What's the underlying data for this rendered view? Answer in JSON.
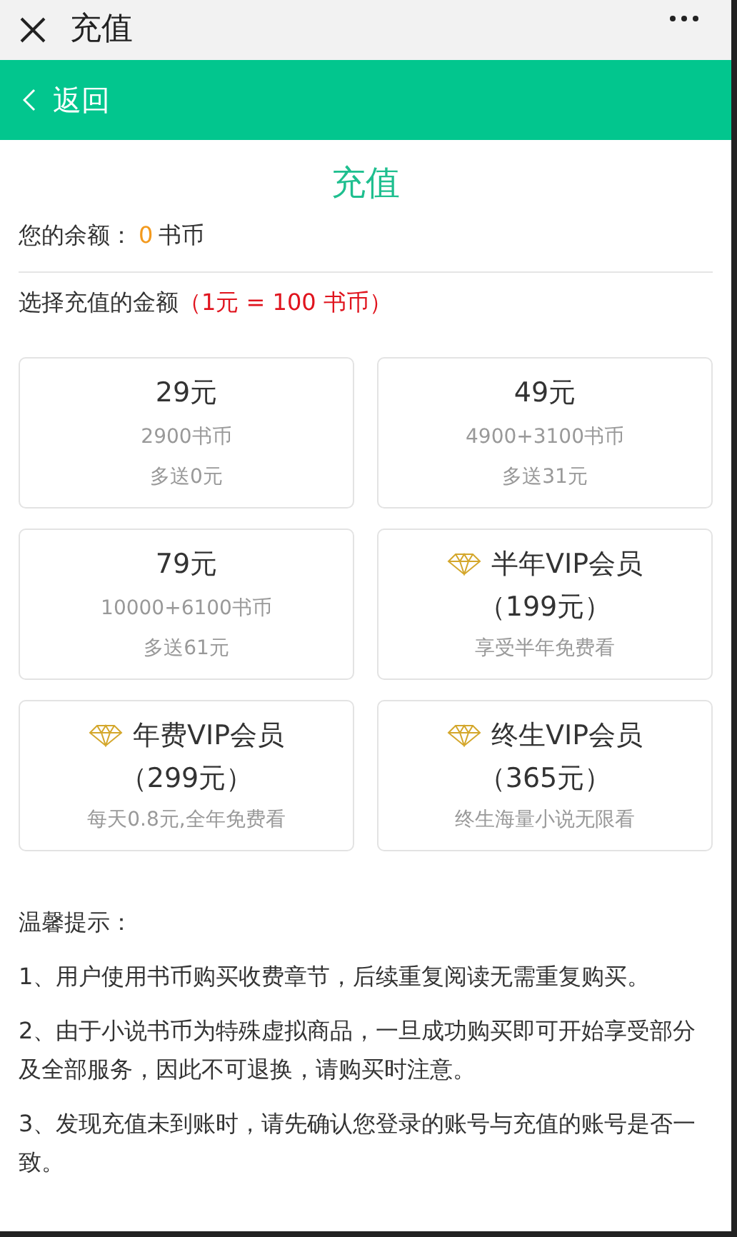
{
  "top_bar": {
    "title": "充值"
  },
  "nav_bar": {
    "back": "返回"
  },
  "page_title": "充值",
  "balance": {
    "label": "您的余额：",
    "amount": "0",
    "unit": "书币"
  },
  "choose": {
    "label": "选择充值的金额",
    "rate": "（1元 = 100 书币）"
  },
  "packages": [
    {
      "kind": "coins",
      "title": "29元",
      "line_2": "2900书币",
      "line_3": "多送0元"
    },
    {
      "kind": "coins",
      "title": "49元",
      "line_2": "4900+3100书币",
      "line_3": "多送31元"
    },
    {
      "kind": "coins",
      "title": "79元",
      "line_2": "10000+6100书币",
      "line_3": "多送61元"
    },
    {
      "kind": "vip",
      "title": "半年VIP会员",
      "line_2": "（199元）",
      "line_3": "享受半年免费看"
    },
    {
      "kind": "vip",
      "title": "年费VIP会员",
      "line_2": "（299元）",
      "line_3": "每天0.8元,全年免费看"
    },
    {
      "kind": "vip",
      "title": "终生VIP会员",
      "line_2": "（365元）",
      "line_3": "终生海量小说无限看"
    }
  ],
  "notes": {
    "title": "温馨提示：",
    "items": [
      "1、用户使用书币购买收费章节，后续重复阅读无需重复购买。",
      "2、由于小说书币为特殊虚拟商品，一旦成功购买即可开始享受部分及全部服务，因此不可退换，请购买时注意。",
      "3、发现充值未到账时，请先确认您登录的账号与充值的账号是否一致。"
    ]
  }
}
